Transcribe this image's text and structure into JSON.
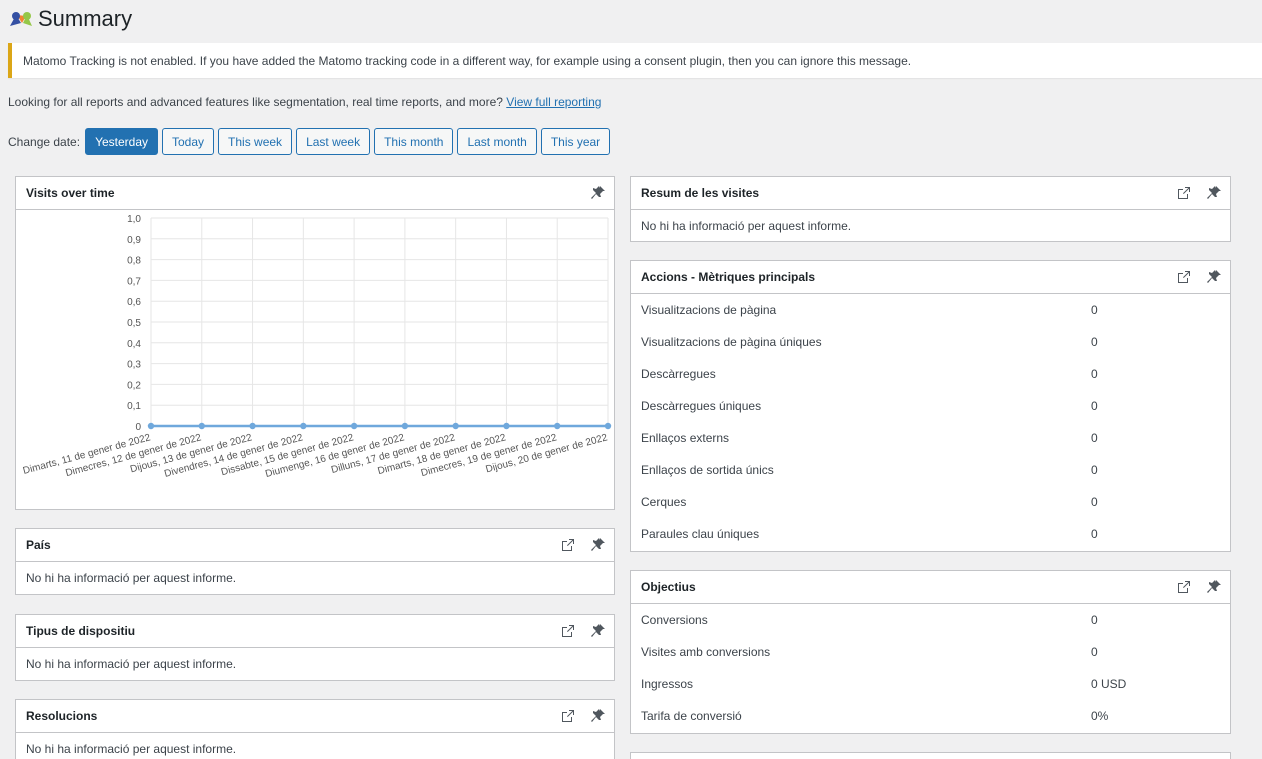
{
  "header": {
    "title": "Summary"
  },
  "notice": {
    "text": "Matomo Tracking is not enabled. If you have added the Matomo tracking code in a different way, for example using a consent plugin, then you can ignore this message."
  },
  "promo": {
    "text": "Looking for all reports and advanced features like segmentation, real time reports, and more? ",
    "link": "View full reporting"
  },
  "change_date": {
    "label": "Change date:",
    "buttons": [
      "Yesterday",
      "Today",
      "This week",
      "Last week",
      "This month",
      "Last month",
      "This year"
    ],
    "active": "Yesterday"
  },
  "visits_over_time": {
    "title": "Visits over time"
  },
  "chart_data": {
    "type": "line",
    "title": "",
    "xlabel": "",
    "ylabel": "",
    "x": [
      "Dimarts, 11 de gener de 2022",
      "Dimecres, 12 de gener de 2022",
      "Dijous, 13 de gener de 2022",
      "Divendres, 14 de gener de 2022",
      "Dissabte, 15 de gener de 2022",
      "Diumenge, 16 de gener de 2022",
      "Dilluns, 17 de gener de 2022",
      "Dimarts, 18 de gener de 2022",
      "Dimecres, 19 de gener de 2022",
      "Dijous, 20 de gener de 2022"
    ],
    "series": [
      {
        "values": [
          0,
          0,
          0,
          0,
          0,
          0,
          0,
          0,
          0,
          0
        ]
      }
    ],
    "ylim": [
      0,
      1
    ],
    "yticks": [
      "1,0",
      "0,9",
      "0,8",
      "0,7",
      "0,6",
      "0,5",
      "0,4",
      "0,3",
      "0,2",
      "0,1",
      "0"
    ],
    "grid": true,
    "color": "#6fa8dc"
  },
  "pais": {
    "title": "País",
    "empty": "No hi ha informació per aquest informe."
  },
  "tipus": {
    "title": "Tipus de dispositiu",
    "empty": "No hi ha informació per aquest informe."
  },
  "resolucions": {
    "title": "Resolucions",
    "empty": "No hi ha informació per aquest informe."
  },
  "resum": {
    "title": "Resum de les visites",
    "empty": "No hi ha informació per aquest informe."
  },
  "accions": {
    "title": "Accions - Mètriques principals",
    "rows": [
      {
        "name": "Visualitzacions de pàgina",
        "value": "0"
      },
      {
        "name": "Visualitzacions de pàgina úniques",
        "value": "0"
      },
      {
        "name": "Descàrregues",
        "value": "0"
      },
      {
        "name": "Descàrregues úniques",
        "value": "0"
      },
      {
        "name": "Enllaços externs",
        "value": "0"
      },
      {
        "name": "Enllaços de sortida únics",
        "value": "0"
      },
      {
        "name": "Cerques",
        "value": "0"
      },
      {
        "name": "Paraules clau úniques",
        "value": "0"
      }
    ]
  },
  "objectius": {
    "title": "Objectius",
    "rows": [
      {
        "name": "Conversions",
        "value": "0"
      },
      {
        "name": "Visites amb conversions",
        "value": "0"
      },
      {
        "name": "Ingressos",
        "value": "0 USD"
      },
      {
        "name": "Tarifa de conversió",
        "value": "0%"
      }
    ]
  },
  "icons": {
    "pin": "pin-icon",
    "export": "external-link-icon"
  },
  "colors": {
    "accent": "#2271b1",
    "notice": "#dba617",
    "line": "#6fa8dc"
  }
}
